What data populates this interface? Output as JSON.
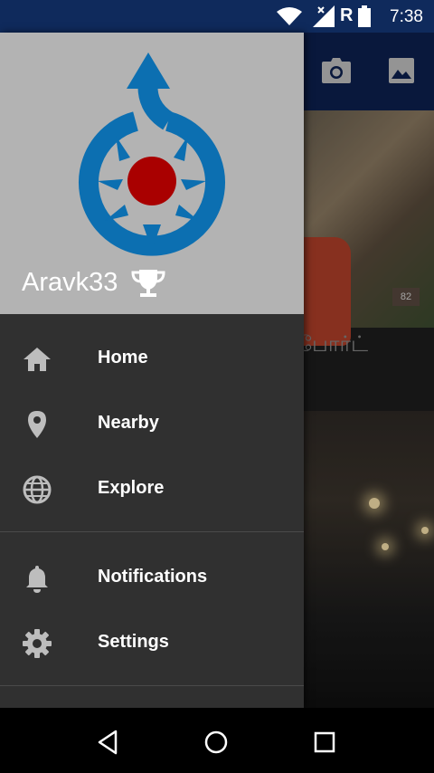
{
  "status_bar": {
    "time": "7:38",
    "network_label": "R",
    "icons": [
      "wifi-icon",
      "signal-icon",
      "battery-icon"
    ]
  },
  "background": {
    "toolbar_icons": [
      "camera-icon",
      "gallery-icon"
    ],
    "caption_partial": "போர்ட்",
    "plaque": "82"
  },
  "drawer": {
    "username": "Aravk33",
    "logo": "wikimedia-commons-logo",
    "items": [
      {
        "label": "Home",
        "icon": "home-icon"
      },
      {
        "label": "Nearby",
        "icon": "location-pin-icon"
      },
      {
        "label": "Explore",
        "icon": "globe-icon"
      },
      {
        "label": "Notifications",
        "icon": "bell-icon"
      },
      {
        "label": "Settings",
        "icon": "gear-icon"
      }
    ]
  },
  "nav_bar": {
    "buttons": [
      "back-icon",
      "home-circle-icon",
      "recents-icon"
    ]
  },
  "colors": {
    "status_bar": "#0f2a5c",
    "drawer_bg": "#303030",
    "header_bg": "#b3b3b3",
    "logo_blue": "#0c6fb1",
    "logo_red": "#a90000"
  }
}
